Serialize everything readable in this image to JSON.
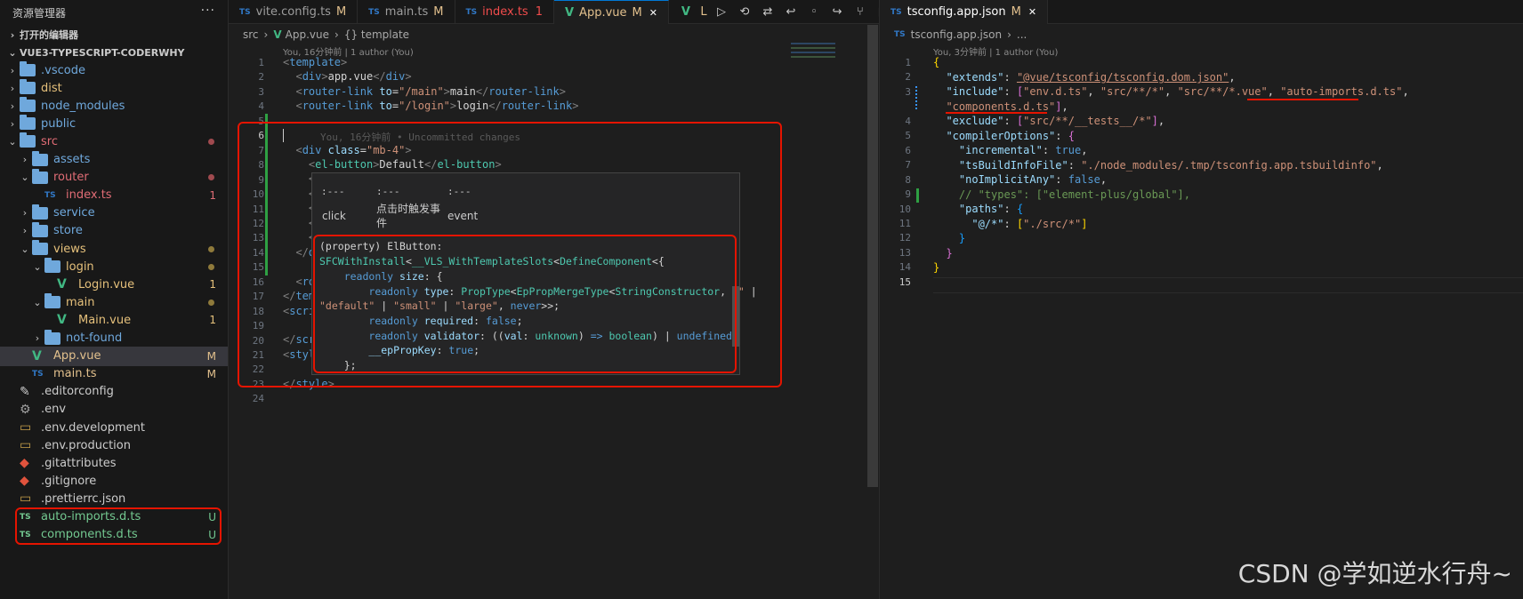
{
  "explorer": {
    "title": "资源管理器",
    "more": "···",
    "open_editors": "打开的编辑器",
    "project": "VUE3-TYPESCRIPT-CODERWHY",
    "items": [
      {
        "label": ".vscode",
        "kind": "folder",
        "color": "#6fa8dc",
        "depth": 1
      },
      {
        "label": "dist",
        "kind": "folder",
        "color": "#e5c07b",
        "depth": 1
      },
      {
        "label": "node_modules",
        "kind": "folder",
        "color": "#6fa8dc",
        "depth": 1
      },
      {
        "label": "public",
        "kind": "folder",
        "color": "#6fa8dc",
        "depth": 1
      },
      {
        "label": "src",
        "kind": "folder-open",
        "color": "#e06c75",
        "depth": 1
      },
      {
        "label": "assets",
        "kind": "folder",
        "color": "#6fa8dc",
        "depth": 2
      },
      {
        "label": "router",
        "kind": "folder-open",
        "color": "#e06c75",
        "depth": 2
      },
      {
        "label": "index.ts",
        "kind": "ts",
        "color": "#e06c75",
        "depth": 3,
        "badge": "1"
      },
      {
        "label": "service",
        "kind": "folder",
        "color": "#6fa8dc",
        "depth": 2
      },
      {
        "label": "store",
        "kind": "folder",
        "color": "#6fa8dc",
        "depth": 2
      },
      {
        "label": "views",
        "kind": "folder-open",
        "color": "#e5c07b",
        "depth": 2
      },
      {
        "label": "login",
        "kind": "folder-open",
        "color": "#e5c07b",
        "depth": 3
      },
      {
        "label": "Login.vue",
        "kind": "vue",
        "color": "#e5c07b",
        "depth": 4,
        "badge": "1"
      },
      {
        "label": "main",
        "kind": "folder-open",
        "color": "#e5c07b",
        "depth": 3
      },
      {
        "label": "Main.vue",
        "kind": "vue",
        "color": "#e5c07b",
        "depth": 4,
        "badge": "1"
      },
      {
        "label": "not-found",
        "kind": "folder",
        "color": "#6fa8dc",
        "depth": 3
      },
      {
        "label": "App.vue",
        "kind": "vue",
        "color": "#e2c08d",
        "depth": 2,
        "badge": "M"
      },
      {
        "label": "main.ts",
        "kind": "ts",
        "color": "#e2c08d",
        "depth": 2,
        "badge": "M"
      },
      {
        "label": ".editorconfig",
        "kind": "cfg",
        "color": "#cccccc",
        "depth": 1
      },
      {
        "label": ".env",
        "kind": "gear",
        "color": "#cccccc",
        "depth": 1
      },
      {
        "label": ".env.development",
        "kind": "file",
        "color": "#cccccc",
        "depth": 1
      },
      {
        "label": ".env.production",
        "kind": "file",
        "color": "#cccccc",
        "depth": 1
      },
      {
        "label": ".gitattributes",
        "kind": "git",
        "color": "#cccccc",
        "depth": 1
      },
      {
        "label": ".gitignore",
        "kind": "git",
        "color": "#cccccc",
        "depth": 1
      },
      {
        "label": ".prettierrc.json",
        "kind": "file",
        "color": "#cccccc",
        "depth": 1
      },
      {
        "label": "auto-imports.d.ts",
        "kind": "ts",
        "color": "#73c991",
        "depth": 1,
        "badge": "U"
      },
      {
        "label": "components.d.ts",
        "kind": "ts",
        "color": "#73c991",
        "depth": 1,
        "badge": "U"
      }
    ]
  },
  "left_tabs": [
    {
      "label": "vite.config.ts",
      "icon": "TS",
      "status": "M"
    },
    {
      "label": "main.ts",
      "icon": "TS",
      "status": "M"
    },
    {
      "label": "index.ts",
      "icon": "TS",
      "status": "1"
    },
    {
      "label": "App.vue",
      "icon": "V",
      "status": "M",
      "close": "✕"
    }
  ],
  "toolbar_letter": "L",
  "left_editor": {
    "breadcrumb": [
      "src",
      "App.vue",
      "{} template"
    ],
    "blame": "You, 16分钟前 | 1 author (You)",
    "inline_blame": "You, 16分钟前 • Uncommitted changes",
    "line_numbers": [
      "1",
      "2",
      "3",
      "4",
      "5",
      "6",
      "7",
      "8",
      "9",
      "10",
      "11",
      "12",
      "13",
      "14",
      "15",
      "16",
      "17",
      "18",
      "19",
      "20",
      "21",
      "22",
      "23",
      "24"
    ]
  },
  "hover": {
    "table_sep": [
      ":---",
      ":---",
      ":---"
    ],
    "table_row": [
      "click",
      "点击时触发事件",
      "event"
    ],
    "signature": "(property) ElButton:"
  },
  "right_tab": {
    "label": "tsconfig.app.json",
    "icon": "TS",
    "status": "M",
    "close": "✕"
  },
  "right_editor": {
    "breadcrumb": [
      "tsconfig.app.json",
      "..."
    ],
    "blame": "You, 3分钟前 | 1 author (You)",
    "line_numbers": [
      "1",
      "2",
      "3",
      "",
      "4",
      "5",
      "6",
      "7",
      "8",
      "9",
      "10",
      "11",
      "12",
      "13",
      "14",
      "15"
    ]
  },
  "watermark": "CSDN @学如逆水行舟~"
}
